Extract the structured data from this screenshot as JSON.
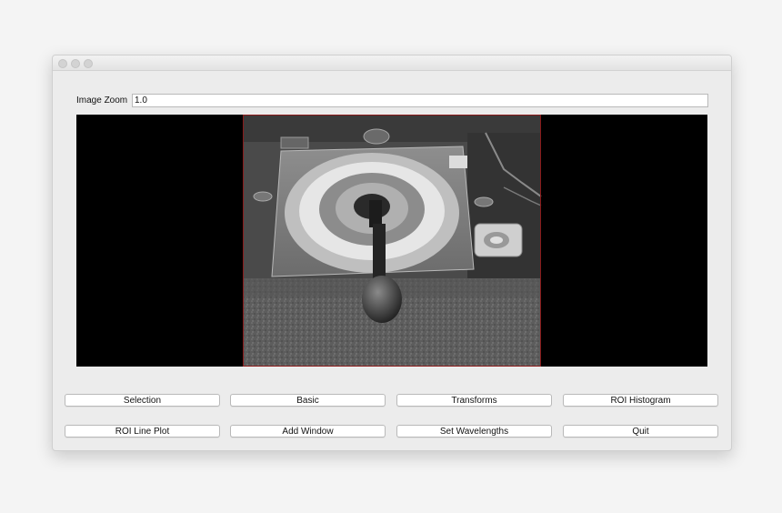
{
  "window": {
    "traffic_lights": [
      "close",
      "minimize",
      "zoom"
    ]
  },
  "zoom": {
    "label": "Image Zoom",
    "value": "1.0"
  },
  "viewer": {
    "image_description": "grayscale-rover-calibration-target"
  },
  "buttons": {
    "row1": [
      "Selection",
      "Basic",
      "Transforms",
      "ROI Histogram"
    ],
    "row2": [
      "ROI Line Plot",
      "Add Window",
      "Set Wavelengths",
      "Quit"
    ]
  },
  "colors": {
    "window_bg": "#ececec",
    "viewer_bg": "#000000",
    "image_border": "#8a1a1a"
  }
}
